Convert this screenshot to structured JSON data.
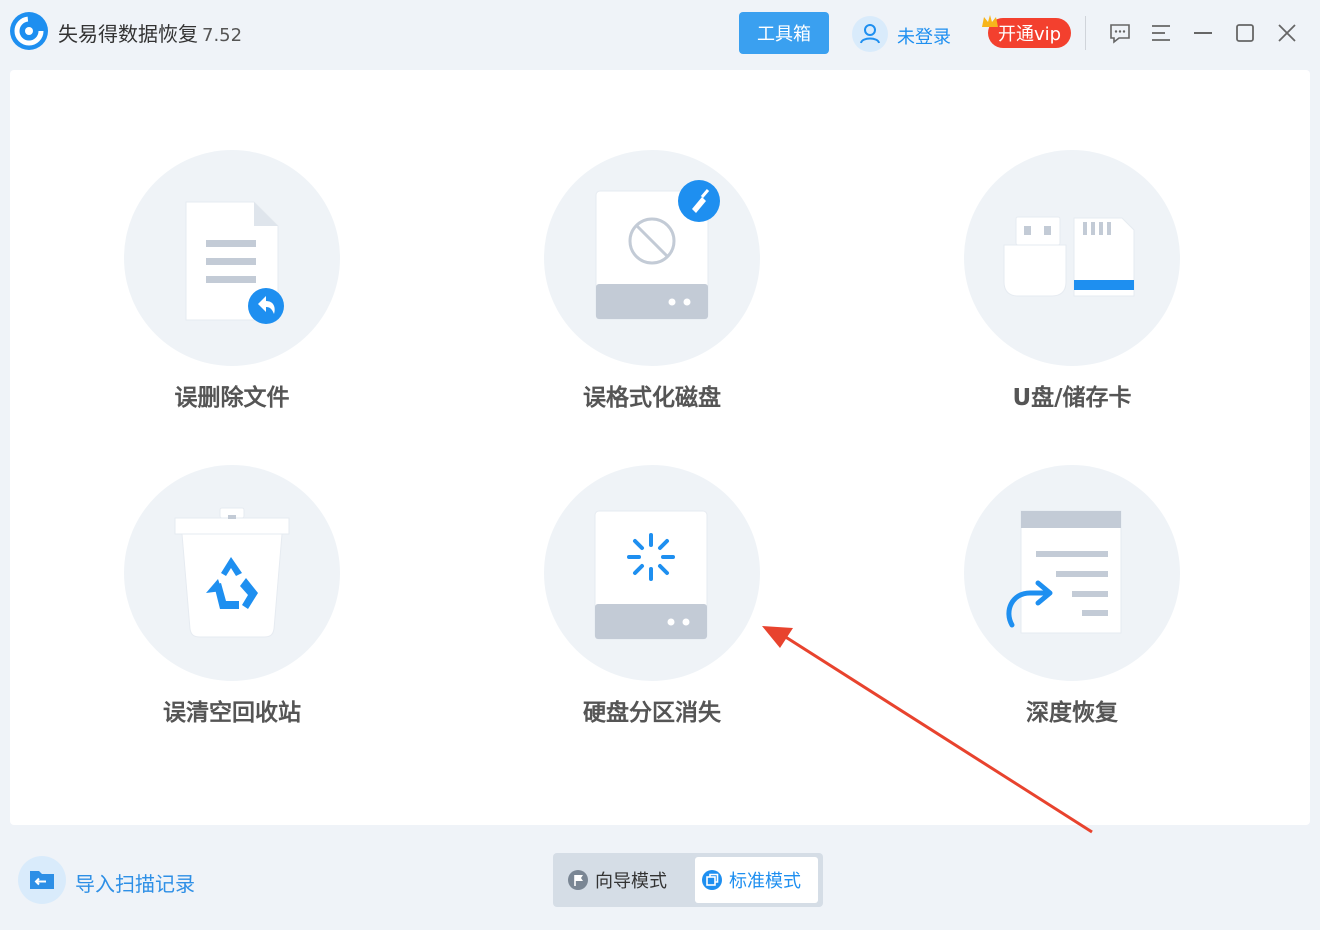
{
  "app": {
    "title": "失易得数据恢复",
    "version": "7.52"
  },
  "header": {
    "toolbox_label": "工具箱",
    "login_label": "未登录",
    "vip_label": "开通vip"
  },
  "window_controls": [
    "feedback-icon",
    "menu-icon",
    "minimize-icon",
    "maximize-icon",
    "close-icon"
  ],
  "recovery_modes": [
    {
      "label": "误删除文件",
      "icon": "deleted-file-icon"
    },
    {
      "label": "误格式化磁盘",
      "icon": "formatted-disk-icon"
    },
    {
      "label": "U盘/储存卡",
      "icon": "usb-sdcard-icon"
    },
    {
      "label": "误清空回收站",
      "icon": "recycle-bin-icon"
    },
    {
      "label": "硬盘分区消失",
      "icon": "lost-partition-icon"
    },
    {
      "label": "深度恢复",
      "icon": "deep-recovery-icon"
    }
  ],
  "footer": {
    "import_label": "导入扫描记录",
    "guide_mode_label": "向导模式",
    "standard_mode_label": "标准模式",
    "active_mode": "标准模式"
  },
  "colors": {
    "accent": "#1e8ff0",
    "vip": "#f3402e",
    "annotation_arrow": "#e8432e",
    "icon_circle": "#eff3f7"
  }
}
